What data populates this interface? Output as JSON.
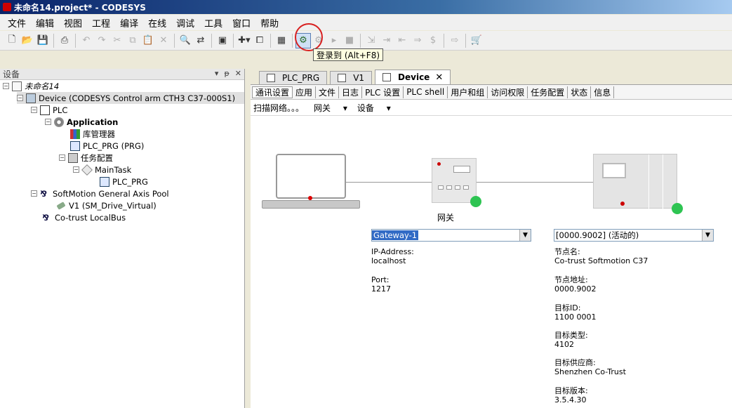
{
  "window": {
    "title": "未命名14.project* - CODESYS"
  },
  "menu": [
    "文件",
    "编辑",
    "视图",
    "工程",
    "编译",
    "在线",
    "调试",
    "工具",
    "窗口",
    "帮助"
  ],
  "toolbar": {
    "icons": [
      "new-project-icon",
      "open-icon",
      "save-icon",
      "print-icon",
      "undo-icon",
      "redo-icon",
      "cut-icon",
      "copy-icon",
      "paste-icon",
      "delete-icon",
      "find-icon",
      "replace-icon",
      "window-icon",
      "add-object-icon",
      "properties-icon",
      "build-icon",
      "login-icon",
      "logout-icon",
      "start-icon",
      "stop-icon",
      "step-icon",
      "step-into-icon",
      "step-out-icon",
      "run-to-cursor-icon",
      "write-values-icon",
      "cart-icon"
    ],
    "login_tooltip": "登录到 (Alt+F8)"
  },
  "devices_panel": {
    "title": "设备",
    "buttons": [
      "▾",
      "ᵽ",
      "✕"
    ],
    "tree": [
      {
        "label": "未命名14",
        "icon": "project-icon",
        "italic": true
      },
      {
        "label": "Device (CODESYS Control arm CTH3 C37-000S1)",
        "icon": "device-icon"
      },
      {
        "label": "PLC",
        "icon": "plc-logic-icon"
      },
      {
        "label": "Application",
        "icon": "application-icon",
        "bold": true
      },
      {
        "label": "库管理器",
        "icon": "library-manager-icon"
      },
      {
        "label": "PLC_PRG (PRG)",
        "icon": "program-icon"
      },
      {
        "label": "任务配置",
        "icon": "task-config-icon"
      },
      {
        "label": "MainTask",
        "icon": "task-icon"
      },
      {
        "label": "PLC_PRG",
        "icon": "program-call-icon"
      },
      {
        "label": "SoftMotion General Axis Pool",
        "icon": "axis-pool-icon"
      },
      {
        "label": "V1 (SM_Drive_Virtual)",
        "icon": "axis-icon"
      },
      {
        "label": "Co-trust LocalBus",
        "icon": "localbus-icon"
      }
    ]
  },
  "editor_tabs": [
    {
      "label": "PLC_PRG",
      "active": false
    },
    {
      "label": "V1",
      "active": false
    },
    {
      "label": "Device",
      "active": true,
      "close": "✕"
    }
  ],
  "device_tabs": [
    "通讯设置",
    "应用",
    "文件",
    "日志",
    "PLC 设置",
    "PLC shell",
    "用户和组",
    "访问权限",
    "任务配置",
    "状态",
    "信息"
  ],
  "scan_bar": {
    "scan": "扫描网络。。。",
    "gateway": "网关",
    "device": "设备"
  },
  "gateway": {
    "diagram_label": "网关",
    "selected": "Gateway-1",
    "ip_label": "IP-Address:",
    "ip_value": "localhost",
    "port_label": "Port:",
    "port_value": "1217"
  },
  "device": {
    "selected": "[0000.9002] (活动的)",
    "node_name_label": "节点名:",
    "node_name": "Co-trust Softmotion C37",
    "node_addr_label": "节点地址:",
    "node_addr": "0000.9002",
    "target_id_label": "目标ID:",
    "target_id": "1100 0001",
    "target_type_label": "目标类型:",
    "target_type": "4102",
    "vendor_label": "目标供应商:",
    "vendor": "Shenzhen Co-Trust",
    "version_label": "目标版本:",
    "version": "3.5.4.30"
  },
  "colors": {
    "status_online": "#2ec452",
    "highlight_circle": "#d82020",
    "title_bar": "#0a246a"
  }
}
